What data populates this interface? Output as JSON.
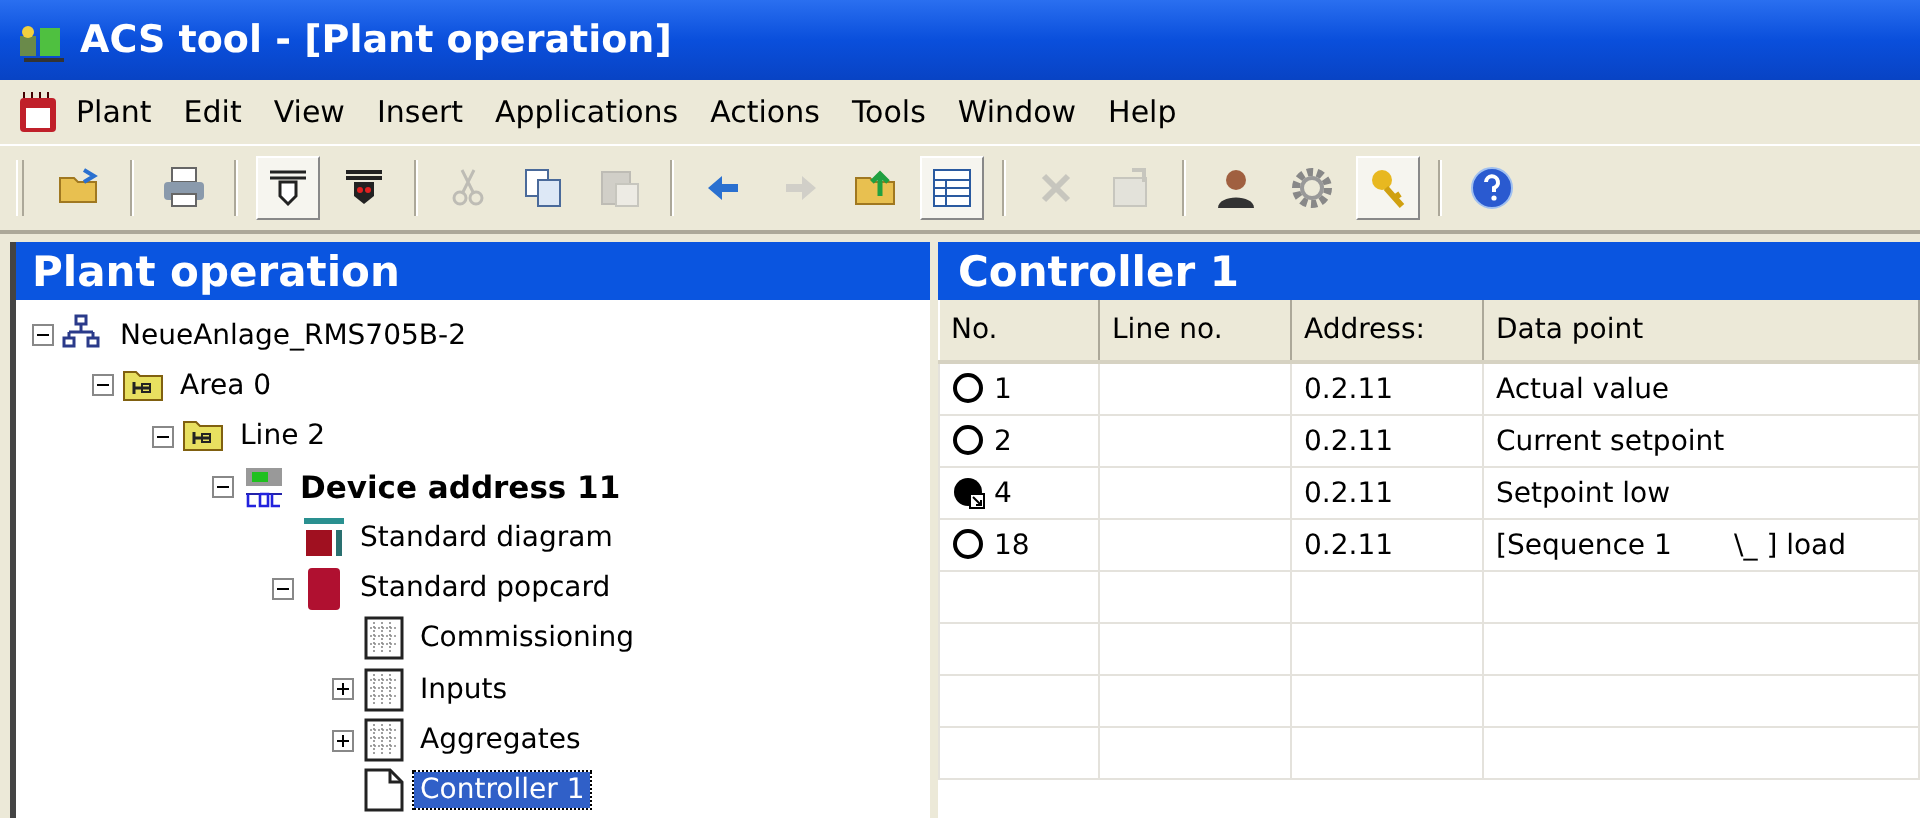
{
  "window": {
    "title": "ACS tool - [Plant operation]"
  },
  "menu": [
    "Plant",
    "Edit",
    "View",
    "Insert",
    "Applications",
    "Actions",
    "Tools",
    "Window",
    "Help"
  ],
  "toolbar": [
    {
      "kind": "open",
      "disabled": false,
      "selected": false
    },
    {
      "kind": "separator"
    },
    {
      "kind": "print",
      "disabled": false,
      "selected": false
    },
    {
      "kind": "separator"
    },
    {
      "kind": "plug",
      "disabled": false,
      "selected": true
    },
    {
      "kind": "plug-red",
      "disabled": false,
      "selected": false
    },
    {
      "kind": "separator"
    },
    {
      "kind": "cut",
      "disabled": true,
      "selected": false
    },
    {
      "kind": "copy",
      "disabled": false,
      "selected": false
    },
    {
      "kind": "paste",
      "disabled": true,
      "selected": false
    },
    {
      "kind": "separator"
    },
    {
      "kind": "back",
      "disabled": false,
      "selected": false
    },
    {
      "kind": "forward",
      "disabled": true,
      "selected": false
    },
    {
      "kind": "folder-up",
      "disabled": false,
      "selected": false
    },
    {
      "kind": "list",
      "disabled": false,
      "selected": true
    },
    {
      "kind": "separator"
    },
    {
      "kind": "delete",
      "disabled": true,
      "selected": false
    },
    {
      "kind": "properties",
      "disabled": true,
      "selected": false
    },
    {
      "kind": "separator"
    },
    {
      "kind": "user",
      "disabled": false,
      "selected": false
    },
    {
      "kind": "gear",
      "disabled": false,
      "selected": false
    },
    {
      "kind": "key",
      "disabled": false,
      "selected": true
    },
    {
      "kind": "separator"
    },
    {
      "kind": "help",
      "disabled": false,
      "selected": false
    }
  ],
  "tree": {
    "title": "Plant operation",
    "items": [
      {
        "label": "NeueAnlage_RMS705B-2",
        "kind": "network",
        "expanded": true,
        "selected": false,
        "children": [
          {
            "label": "Area 0",
            "kind": "folder",
            "expanded": true,
            "selected": false,
            "children": [
              {
                "label": "Line 2",
                "kind": "folder",
                "expanded": true,
                "selected": false,
                "children": [
                  {
                    "label": "Device address 11",
                    "kind": "device",
                    "expanded": true,
                    "selected": false,
                    "children": [
                      {
                        "label": "Standard diagram",
                        "kind": "diagram",
                        "selected": false
                      },
                      {
                        "label": "Standard popcard",
                        "kind": "popcard",
                        "expanded": true,
                        "selected": false,
                        "children": [
                          {
                            "label": "Commissioning",
                            "kind": "page",
                            "selected": false
                          },
                          {
                            "label": "Inputs",
                            "kind": "page",
                            "expanded": false,
                            "selected": false
                          },
                          {
                            "label": "Aggregates",
                            "kind": "page",
                            "expanded": false,
                            "selected": false
                          },
                          {
                            "label": "Controller 1",
                            "kind": "document",
                            "selected": true
                          }
                        ]
                      }
                    ]
                  }
                ]
              }
            ]
          }
        ]
      }
    ]
  },
  "table": {
    "title": "Controller 1",
    "columns": [
      "No.",
      "Line no.",
      "Address:",
      "Data point"
    ],
    "rows": [
      {
        "kind": "plain",
        "no": "1",
        "address": "0.2.11",
        "data_point": "Actual value"
      },
      {
        "kind": "plain",
        "no": "2",
        "address": "0.2.11",
        "data_point": "Current setpoint"
      },
      {
        "kind": "linked",
        "no": "4",
        "address": "0.2.11",
        "data_point": "Setpoint low"
      },
      {
        "kind": "plain",
        "no": "18",
        "address": "0.2.11",
        "data_point": "[Sequence 1       \\_ ] load"
      }
    ]
  }
}
